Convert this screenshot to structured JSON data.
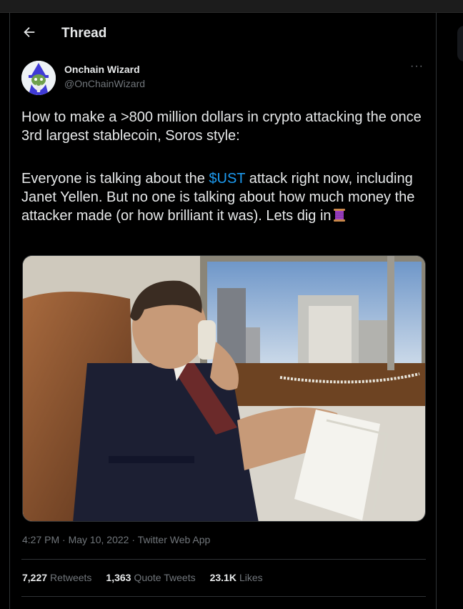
{
  "header": {
    "title": "Thread"
  },
  "author": {
    "name": "Onchain Wizard",
    "handle": "@OnChainWizard"
  },
  "tweet": {
    "p1": "How to make a >800 million dollars in crypto attacking the once 3rd largest stablecoin, Soros style:",
    "p2_before": "Everyone is talking about the ",
    "cashtag": "$UST",
    "p2_after": " attack right now, including Janet Yellen. But no one is talking about how much money the attacker made (or how brilliant it was). Lets dig in"
  },
  "meta": {
    "time": "4:27 PM",
    "date": "May 10, 2022",
    "source": "Twitter Web App",
    "sep": "·"
  },
  "stats": [
    {
      "count": "7,227",
      "label": "Retweets"
    },
    {
      "count": "1,363",
      "label": "Quote Tweets"
    },
    {
      "count": "23.1K",
      "label": "Likes"
    }
  ],
  "icons": {
    "back": "arrow-left-icon",
    "more": "more-icon",
    "spool": "thread-spool-emoji"
  },
  "colors": {
    "accent": "#1d9bf0",
    "text": "#e7e9ea",
    "muted": "#71767b",
    "background": "#000000"
  }
}
